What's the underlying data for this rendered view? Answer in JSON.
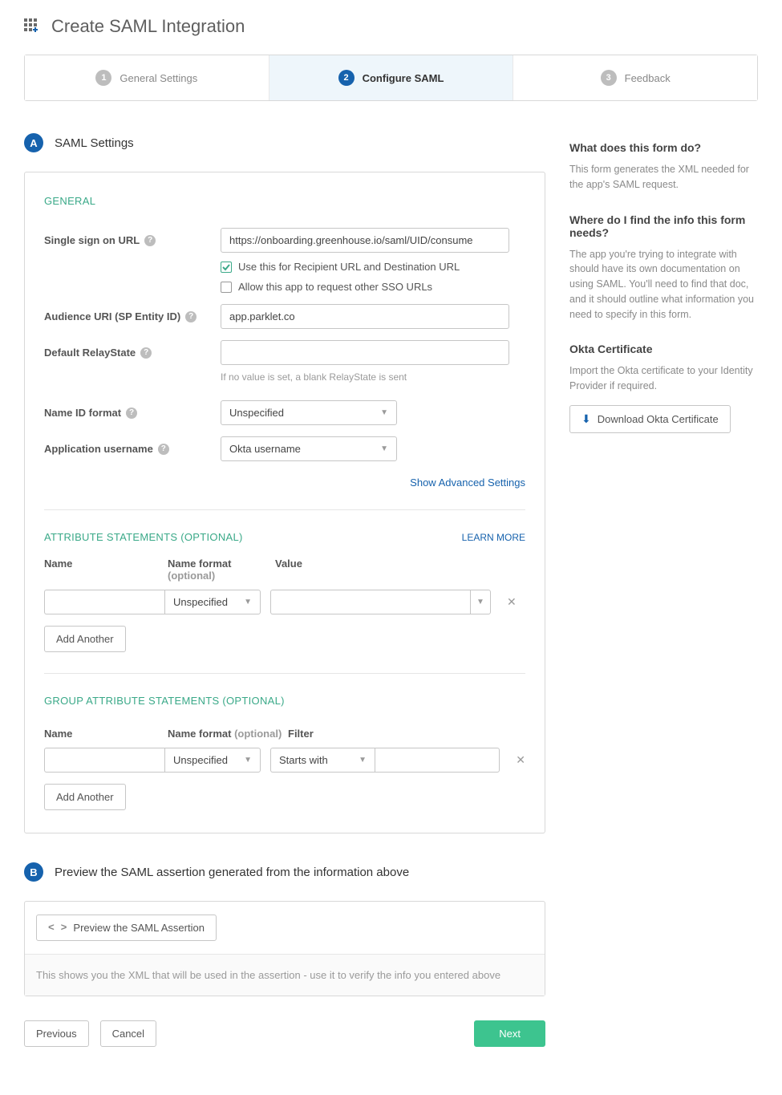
{
  "page_title": "Create SAML Integration",
  "wizard": {
    "steps": [
      {
        "num": "1",
        "label": "General Settings"
      },
      {
        "num": "2",
        "label": "Configure SAML"
      },
      {
        "num": "3",
        "label": "Feedback"
      }
    ]
  },
  "section_a": {
    "badge": "A",
    "title": "SAML Settings",
    "general_heading": "GENERAL",
    "sso_url_label": "Single sign on URL",
    "sso_url_value": "https://onboarding.greenhouse.io/saml/UID/consume",
    "cb_recipient": "Use this for Recipient URL and Destination URL",
    "cb_other_sso": "Allow this app to request other SSO URLs",
    "audience_label": "Audience URI (SP Entity ID)",
    "audience_value": "app.parklet.co",
    "relaystate_label": "Default RelayState",
    "relaystate_value": "",
    "relaystate_hint": "If no value is set, a blank RelayState is sent",
    "nameid_label": "Name ID format",
    "nameid_value": "Unspecified",
    "appuser_label": "Application username",
    "appuser_value": "Okta username",
    "advanced_link": "Show Advanced Settings",
    "attr_heading": "ATTRIBUTE STATEMENTS (OPTIONAL)",
    "learn_more": "LEARN MORE",
    "col_name": "Name",
    "col_format": "Name format",
    "col_optional": "(optional)",
    "col_value": "Value",
    "attr_format_value": "Unspecified",
    "add_another": "Add Another",
    "group_heading": "GROUP ATTRIBUTE STATEMENTS (OPTIONAL)",
    "col_filter": "Filter",
    "group_format_value": "Unspecified",
    "filter_value": "Starts with"
  },
  "section_b": {
    "badge": "B",
    "title": "Preview the SAML assertion generated from the information above",
    "preview_btn": "Preview the SAML Assertion",
    "preview_hint": "This shows you the XML that will be used in the assertion - use it to verify the info you entered above"
  },
  "buttons": {
    "previous": "Previous",
    "cancel": "Cancel",
    "next": "Next"
  },
  "sidebar": {
    "h1": "What does this form do?",
    "p1": "This form generates the XML needed for the app's SAML request.",
    "h2": "Where do I find the info this form needs?",
    "p2": "The app you're trying to integrate with should have its own documentation on using SAML. You'll need to find that doc, and it should outline what information you need to specify in this form.",
    "h3": "Okta Certificate",
    "p3": "Import the Okta certificate to your Identity Provider if required.",
    "download_btn": "Download Okta Certificate"
  }
}
